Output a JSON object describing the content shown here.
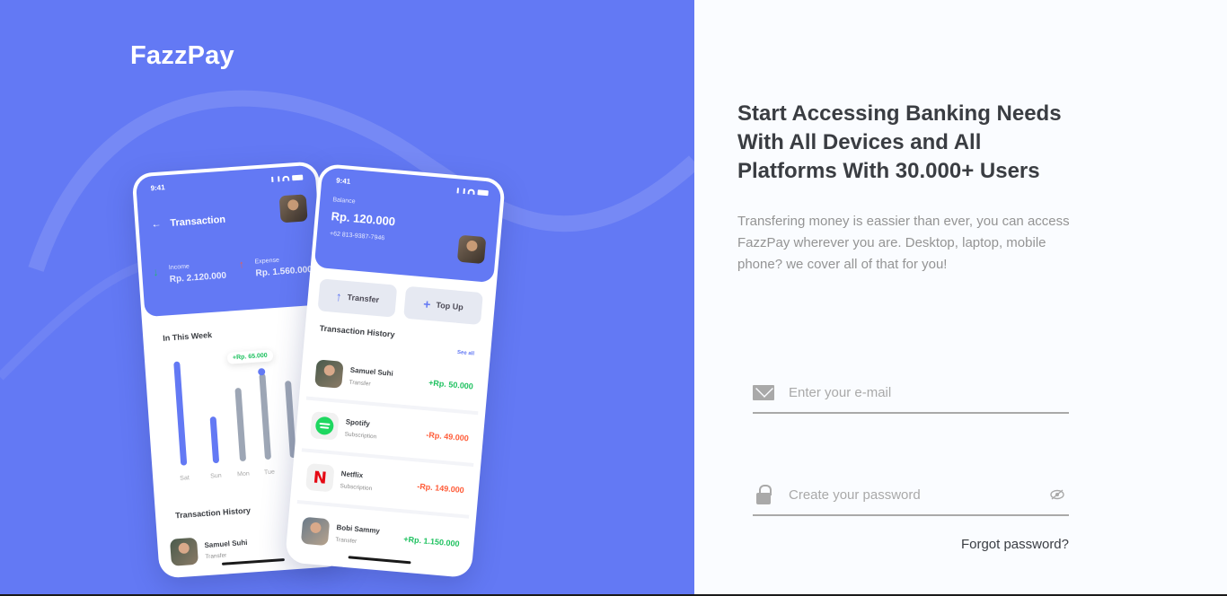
{
  "brand": {
    "name": "FazzPay"
  },
  "phone_left": {
    "time": "9:41",
    "title": "Transaction",
    "income_label": "Income",
    "income_amount": "Rp. 2.120.000",
    "expense_label": "Expense",
    "expense_amount": "Rp. 1.560.000",
    "week_title": "In This Week",
    "tooltip": "+Rp. 65.000",
    "days": [
      "Sat",
      "Sun",
      "Mon",
      "Tue"
    ],
    "history_title": "Transaction History",
    "history_name": "Samuel Suhi",
    "history_sub": "Transfer"
  },
  "phone_right": {
    "time": "9:41",
    "balance_label": "Balance",
    "balance": "Rp. 120.000",
    "phone_number": "+62 813-9387-7946",
    "transfer_label": "Transfer",
    "topup_label": "Top Up",
    "history_title": "Transaction History",
    "see_all": "See all",
    "transactions": [
      {
        "name": "Samuel Suhi",
        "type": "Transfer",
        "amount": "+Rp. 50.000",
        "positive": true
      },
      {
        "name": "Spotify",
        "type": "Subscription",
        "amount": "-Rp. 49.000",
        "positive": false
      },
      {
        "name": "Netflix",
        "type": "Subscription",
        "amount": "-Rp. 149.000",
        "positive": false
      },
      {
        "name": "Bobi Sammy",
        "type": "Transfer",
        "amount": "+Rp. 1.150.000",
        "positive": true
      }
    ]
  },
  "form": {
    "headline": "Start Accessing Banking Needs With All Devices and All Platforms With 30.000+ Users",
    "description": "Transfering money is eassier than ever, you can access FazzPay wherever you are. Desktop, laptop, mobile phone? we cover all of that for you!",
    "email_placeholder": "Enter your e-mail",
    "password_placeholder": "Create your password",
    "forgot_label": "Forgot password?"
  },
  "colors": {
    "primary": "#6379f4",
    "positive": "#1ec15f",
    "negative": "#ff5b37",
    "text": "#3a3d42",
    "muted": "#a9a9a9"
  }
}
